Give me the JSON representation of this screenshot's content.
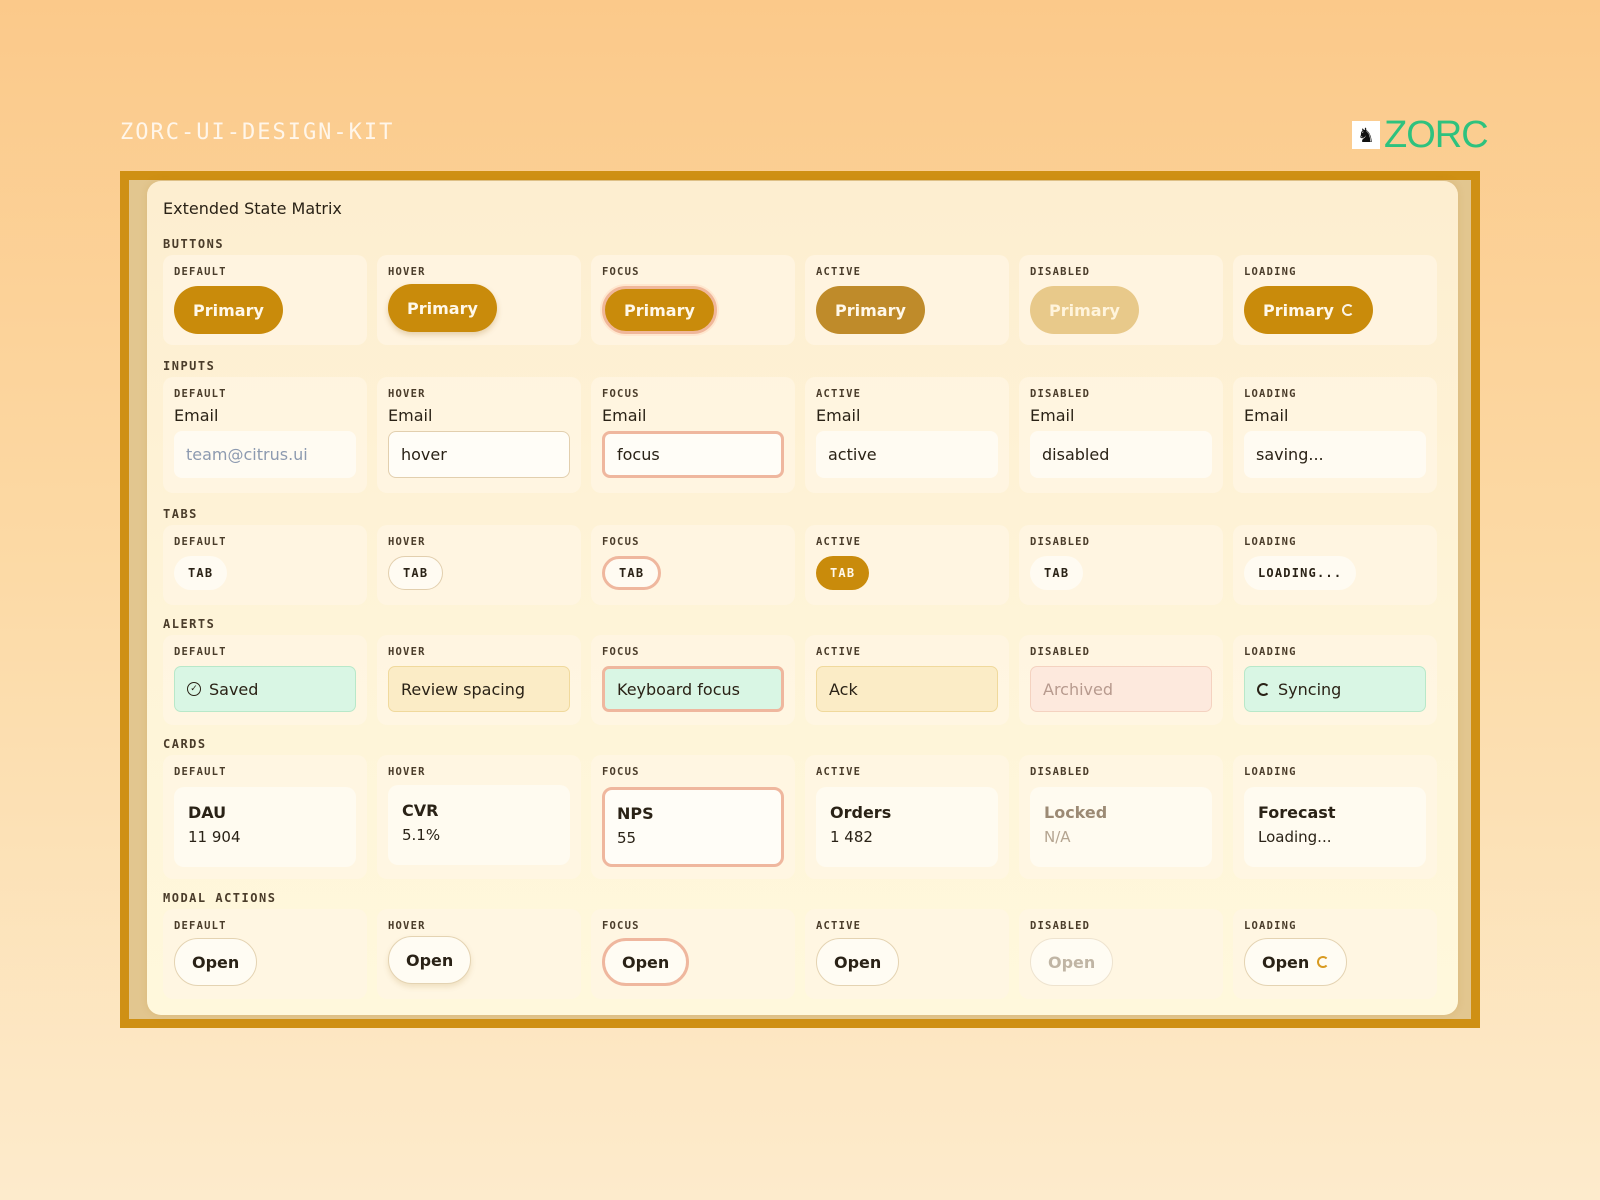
{
  "kit_title": "ZORC-UI-DESIGN-KIT",
  "brand": {
    "name": "ZORC",
    "icon": "wolf-logo-icon",
    "color": "#2ec27e"
  },
  "panel_title": "Extended State Matrix",
  "states": [
    "DEFAULT",
    "HOVER",
    "FOCUS",
    "ACTIVE",
    "DISABLED",
    "LOADING"
  ],
  "sections": {
    "buttons": {
      "label": "BUTTONS",
      "button_label": "Primary"
    },
    "inputs": {
      "label": "INPUTS",
      "field_label": "Email",
      "default_placeholder": "team@citrus.ui",
      "values": [
        "hover",
        "focus",
        "active",
        "disabled",
        "saving..."
      ]
    },
    "tabs": {
      "label": "TABS",
      "tab_label": "TAB",
      "loading_label": "LOADING..."
    },
    "alerts": {
      "label": "ALERTS",
      "items": [
        "Saved",
        "Review spacing",
        "Keyboard focus",
        "Ack",
        "Archived",
        "Syncing"
      ]
    },
    "cards": {
      "label": "CARDS",
      "items": [
        {
          "title": "DAU",
          "value": "11 904"
        },
        {
          "title": "CVR",
          "value": "5.1%"
        },
        {
          "title": "NPS",
          "value": "55"
        },
        {
          "title": "Orders",
          "value": "1 482"
        },
        {
          "title": "Locked",
          "value": "N/A"
        },
        {
          "title": "Forecast",
          "value": "Loading..."
        }
      ]
    },
    "modal_actions": {
      "label": "MODAL ACTIONS",
      "button_label": "Open"
    }
  },
  "colors": {
    "accent": "#c98b0b",
    "frame": "#cf9014",
    "focus_ring": "#efb79e",
    "success_bg": "#d9f6e4",
    "warn_bg": "#fbecc6",
    "archived_bg": "#fde9dd"
  }
}
